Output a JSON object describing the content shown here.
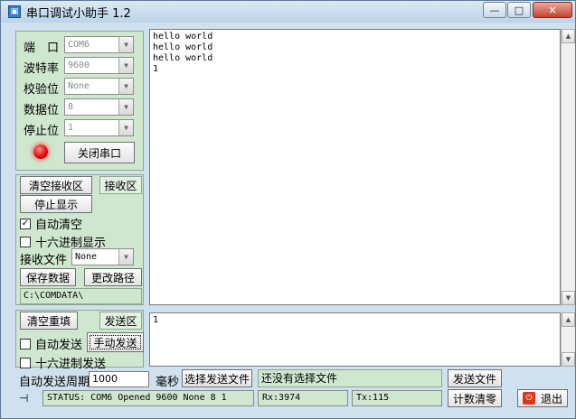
{
  "window": {
    "title": "串口调试小助手 1.2",
    "app_icon": "serial-port-icon",
    "min": "—",
    "max": "□",
    "close": "✕"
  },
  "settings": {
    "port_label": "端　口",
    "port_value": "COM6",
    "baud_label": "波特率",
    "baud_value": "9600",
    "parity_label": "校验位",
    "parity_value": "None",
    "data_label": "数据位",
    "data_value": "8",
    "stop_label": "停止位",
    "stop_value": "1",
    "open_close_label": "关闭串口"
  },
  "receive": {
    "clear_label": "清空接收区",
    "area_label": "接收区",
    "stop_display_label": "停止显示",
    "auto_clear_label": "自动清空",
    "auto_clear_checked": true,
    "hex_display_label": "十六进制显示",
    "hex_display_checked": false,
    "file_label": "接收文件",
    "file_value": "None",
    "save_label": "保存数据",
    "change_path_label": "更改路径",
    "path": "C:\\COMDATA\\",
    "lines": [
      "hello world",
      "hello world",
      "hello world",
      "1"
    ]
  },
  "send": {
    "clear_label": "清空重填",
    "area_label": "发送区",
    "auto_send_label": "自动发送",
    "auto_send_checked": false,
    "manual_send_label": "手动发送",
    "hex_send_label": "十六进制发送",
    "hex_send_checked": false,
    "content": "1",
    "period_label": "自动发送周期",
    "period_value": "1000",
    "period_unit": "毫秒",
    "choose_file_label": "选择发送文件",
    "file_status": "还没有选择文件",
    "send_file_label": "发送文件"
  },
  "statusbar": {
    "icon": "port-plug-icon",
    "status": "STATUS: COM6 Opened 9600 None 8 1",
    "rx": "Rx:3974",
    "tx": "Tx:115",
    "reset_count_label": "计数清零",
    "exit_label": "退出",
    "exit_icon": "power-icon"
  }
}
